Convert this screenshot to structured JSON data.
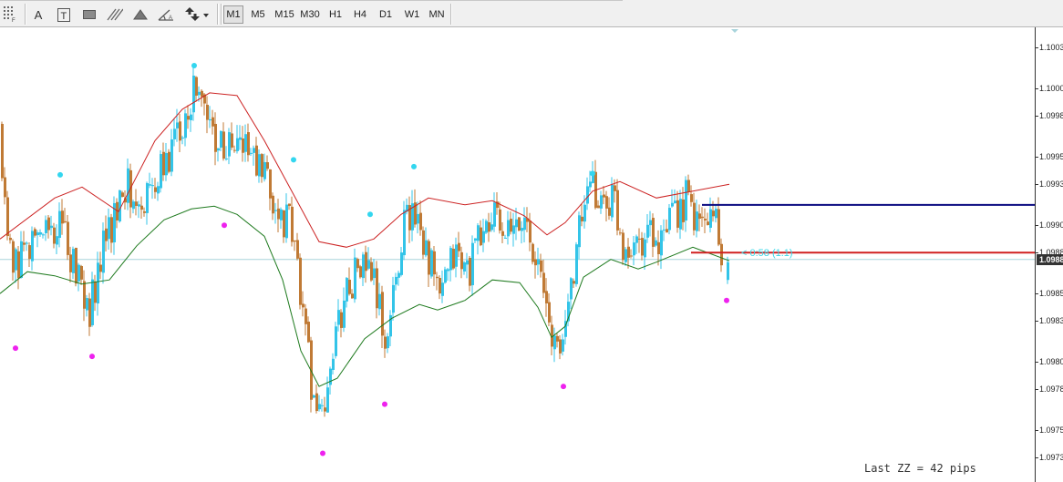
{
  "toolbar": {
    "tools": [
      {
        "name": "crosshair-grid-icon",
        "glyph": ""
      },
      {
        "name": "text-tool",
        "glyph": "A"
      },
      {
        "name": "text-label-tool",
        "glyph": "T"
      },
      {
        "name": "rectangle-tool",
        "glyph": ""
      },
      {
        "name": "channel-tool",
        "glyph": ""
      },
      {
        "name": "triangle-tool",
        "glyph": ""
      },
      {
        "name": "angle-tool",
        "glyph": ""
      },
      {
        "name": "arrows-tool",
        "glyph": ""
      }
    ],
    "timeframes": [
      "M1",
      "M5",
      "M15",
      "M30",
      "H1",
      "H4",
      "D1",
      "W1",
      "MN"
    ],
    "active_timeframe": "M1"
  },
  "price_axis": {
    "labels": [
      "1.1003",
      "1.1000",
      "1.0998",
      "1.0995",
      "1.0993",
      "1.0990",
      "1.0988",
      "1.0985",
      "1.0983",
      "1.0980",
      "1.0978",
      "1.0975",
      "1.0973"
    ],
    "current_price": "1.0988"
  },
  "chart": {
    "timer_text": "< 0:58 (1.1)",
    "zigzag_text": "Last ZZ = 42 pips",
    "colors": {
      "bull": "#33c4e8",
      "bear": "#c07a35",
      "upper_band": "#cc2222",
      "lower_band": "#1e7a1e",
      "high_dot": "#33d6ef",
      "low_dot": "#ee22ee",
      "resistance": "#0a0a80",
      "support": "#d02020",
      "bid_line": "#a8d4dc"
    }
  },
  "chart_data": {
    "type": "candlestick",
    "y_range": [
      1.09718,
      1.10033
    ],
    "upper_band": [
      [
        0,
        1.0989
      ],
      [
        60,
        1.0992
      ],
      [
        90,
        1.09928
      ],
      [
        130,
        1.0991
      ],
      [
        170,
        1.09962
      ],
      [
        200,
        1.09985
      ],
      [
        230,
        1.09997
      ],
      [
        260,
        1.09995
      ],
      [
        290,
        1.09962
      ],
      [
        320,
        1.09925
      ],
      [
        350,
        1.09888
      ],
      [
        380,
        1.09884
      ],
      [
        410,
        1.0989
      ],
      [
        440,
        1.09908
      ],
      [
        470,
        1.0992
      ],
      [
        510,
        1.09915
      ],
      [
        540,
        1.09918
      ],
      [
        575,
        1.09907
      ],
      [
        600,
        1.09893
      ],
      [
        620,
        1.09902
      ],
      [
        650,
        1.09925
      ],
      [
        680,
        1.09932
      ],
      [
        720,
        1.0992
      ],
      [
        760,
        1.09925
      ],
      [
        800,
        1.0993
      ]
    ],
    "lower_band": [
      [
        0,
        1.0985
      ],
      [
        30,
        1.09866
      ],
      [
        60,
        1.09863
      ],
      [
        90,
        1.09857
      ],
      [
        120,
        1.0986
      ],
      [
        150,
        1.09885
      ],
      [
        180,
        1.09904
      ],
      [
        210,
        1.09912
      ],
      [
        235,
        1.09914
      ],
      [
        260,
        1.09908
      ],
      [
        290,
        1.09892
      ],
      [
        310,
        1.0986
      ],
      [
        330,
        1.09808
      ],
      [
        350,
        1.09782
      ],
      [
        370,
        1.09788
      ],
      [
        400,
        1.09817
      ],
      [
        430,
        1.09832
      ],
      [
        460,
        1.09842
      ],
      [
        480,
        1.09838
      ],
      [
        510,
        1.09845
      ],
      [
        540,
        1.0986
      ],
      [
        570,
        1.09858
      ],
      [
        590,
        1.0984
      ],
      [
        605,
        1.09818
      ],
      [
        620,
        1.09826
      ],
      [
        640,
        1.09862
      ],
      [
        670,
        1.09875
      ],
      [
        700,
        1.09868
      ],
      [
        720,
        1.09873
      ],
      [
        760,
        1.09884
      ],
      [
        800,
        1.09874
      ]
    ],
    "high_dots": [
      [
        66,
        1.09937
      ],
      [
        213,
        1.10017
      ],
      [
        322,
        1.09948
      ],
      [
        406,
        1.09908
      ],
      [
        454,
        1.09943
      ],
      [
        650,
        1.09938
      ]
    ],
    "low_dots": [
      [
        17,
        1.0981
      ],
      [
        101,
        1.09804
      ],
      [
        246,
        1.099
      ],
      [
        354,
        1.09733
      ],
      [
        422,
        1.09769
      ],
      [
        618,
        1.09782
      ],
      [
        797,
        1.09845
      ]
    ],
    "resistance_line": {
      "price": 1.09915,
      "from_x": 770
    },
    "support_line": {
      "price": 1.0988,
      "from_x": 758
    },
    "bid_price": 1.09875,
    "last_candle": {
      "x": 798,
      "open": 1.0986,
      "close": 1.09873,
      "high": 1.09877,
      "low": 1.09857,
      "direction": "up"
    },
    "keypoints": [
      [
        0,
        1.0997
      ],
      [
        10,
        1.0988
      ],
      [
        25,
        1.09875
      ],
      [
        50,
        1.099
      ],
      [
        70,
        1.09895
      ],
      [
        85,
        1.0987
      ],
      [
        100,
        1.0984
      ],
      [
        120,
        1.09895
      ],
      [
        140,
        1.0993
      ],
      [
        160,
        1.0992
      ],
      [
        185,
        1.09945
      ],
      [
        200,
        1.09975
      ],
      [
        215,
        1.1
      ],
      [
        235,
        1.0997
      ],
      [
        250,
        1.09955
      ],
      [
        270,
        1.0996
      ],
      [
        290,
        1.09935
      ],
      [
        305,
        1.0991
      ],
      [
        320,
        1.099
      ],
      [
        330,
        1.0986
      ],
      [
        345,
        1.09775
      ],
      [
        355,
        1.09755
      ],
      [
        365,
        1.098
      ],
      [
        380,
        1.0985
      ],
      [
        395,
        1.0987
      ],
      [
        410,
        1.09865
      ],
      [
        425,
        1.0981
      ],
      [
        445,
        1.09905
      ],
      [
        460,
        1.0991
      ],
      [
        470,
        1.0988
      ],
      [
        485,
        1.09845
      ],
      [
        500,
        1.0988
      ],
      [
        515,
        1.09865
      ],
      [
        530,
        1.09895
      ],
      [
        545,
        1.09905
      ],
      [
        560,
        1.0989
      ],
      [
        580,
        1.09905
      ],
      [
        590,
        1.09875
      ],
      [
        600,
        1.0984
      ],
      [
        615,
        1.098
      ],
      [
        625,
        1.09845
      ],
      [
        640,
        1.0991
      ],
      [
        650,
        1.09925
      ],
      [
        665,
        1.09915
      ],
      [
        675,
        1.0992
      ],
      [
        685,
        1.09885
      ],
      [
        700,
        1.0989
      ],
      [
        715,
        1.09895
      ],
      [
        725,
        1.0988
      ],
      [
        740,
        1.09905
      ],
      [
        755,
        1.0992
      ],
      [
        765,
        1.099
      ],
      [
        778,
        1.09905
      ],
      [
        788,
        1.0991
      ],
      [
        795,
        1.0986
      ]
    ]
  }
}
